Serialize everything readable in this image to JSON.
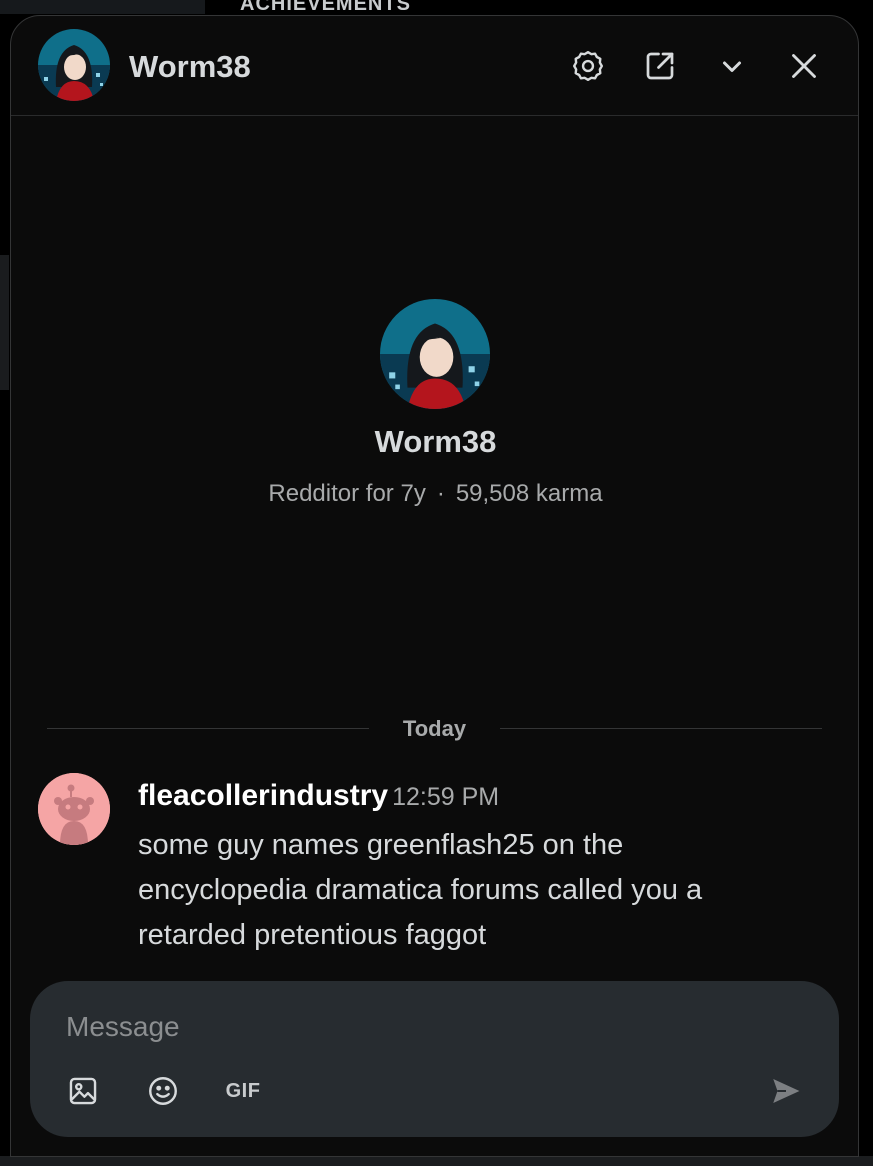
{
  "background": {
    "heading": "ACHIEVEMENTS"
  },
  "chat": {
    "title": "Worm38",
    "header_buttons": {
      "settings_icon": "gear-icon",
      "popout_icon": "external-link-icon",
      "collapse_icon": "chevron-down-icon",
      "close_icon": "close-icon"
    },
    "profile": {
      "username": "Worm38",
      "account_age": "Redditor for 7y",
      "separator": "·",
      "karma": "59,508 karma"
    },
    "date_divider": "Today",
    "messages": [
      {
        "author": "fleacollerindustry",
        "time": "12:59 PM",
        "text": "some guy names greenflash25 on the encyclopedia dramatica forums called you a retarded pretentious faggot"
      }
    ],
    "composer": {
      "placeholder": "Message",
      "gif_label": "GIF"
    }
  },
  "colors": {
    "window_bg": "#0b0b0b",
    "composer_bg": "#272c30",
    "default_avatar_bg": "#f5a5a5",
    "text_primary": "#d7dadc",
    "text_secondary": "#a8aaab"
  }
}
